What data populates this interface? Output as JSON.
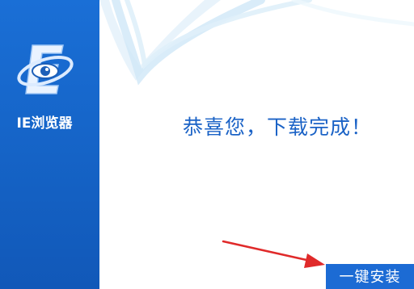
{
  "app": {
    "name": "IE浏览器",
    "icon": "ie-browser-logo-icon"
  },
  "main": {
    "message": "恭喜您，下载完成！"
  },
  "actions": {
    "install_label": "一键安装"
  },
  "colors": {
    "sidebar": "#1563c6",
    "message_text": "#1a62c6",
    "button": "#1c6bd4",
    "arrow": "#e02a2a"
  }
}
